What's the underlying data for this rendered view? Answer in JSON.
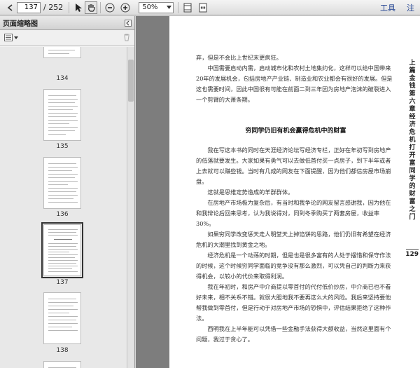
{
  "toolbar": {
    "current_page": "137",
    "page_total": "/ 252",
    "zoom": "50%",
    "tools_label": "工具",
    "comment_label": "注"
  },
  "sidebar": {
    "title": "页面缩略图",
    "thumbnails": [
      {
        "label": "134"
      },
      {
        "label": "135"
      },
      {
        "label": "136"
      },
      {
        "label": "137",
        "selected": true
      },
      {
        "label": "138"
      }
    ]
  },
  "document": {
    "running_head": "上篇 金钱 第六章 经济危机打开富同学的财富之门",
    "page_number": "129",
    "top_paragraphs": [
      "弃，但是不会比上世纪末更疯狂。",
      "中国需要启动内需，启动城市化和农村土地集约化，这样可以给中国带来20年的发展机会，包括房地产产业链、制造业和农业都会有很好的发展。但是这也需要时间，因此中国很有可能在前面二到三年因为房地产泡沫的破裂进入一个剪臂的大萧条期。"
    ],
    "heading": "穷同学仍旧有机会赢得危机中的财富",
    "paragraphs": [
      "我在写这本书的同时在天涯经济论坛写经济专栏，正好在年初写到房地产的低落就要发生。大家如果有勇气可以去做低首付买一点房子，到下半年或者上去就可以赚些钱。当时有几成的网友在下面提醒，因为他们都信房屋市场崩盘。",
      "这就是思维定势造成的羊群群体。",
      "在房地产市场极为复杂后，有当时和我争论的网友留言感谢我，因为他在和我辩论后回来思考，认为我说得对，同到冬季购买了两套房屋，收益率30%。",
      "如果穷同学改变惩天走人明堂天上掉馅饼的思路，他们仍旧有希望在经济危机的大潮里找到黄金之地。",
      "经济危机是一个动荡的时期，但是也是很多富有的人处于摆惜和保守作法的时候，这个时候穷同学面临的竞争没有那么激烈，可以凭自己的判断力来获得机会，以较小的代价来取得利润。",
      "我在年初时，和房产中介商提以零首付的代付低价炒房，中介商已也不看好未来，相不关系不错。就很大胆地我不要再这么大的风险。我后来坚持要他帮我做到零首付，但是行动于对房地产市场的恐惧中，评估结果拒绝了这种作法。",
      "西明我在上半年能可以凭借一些金融手法获得大额收益，当然这里面有个问题，我过于贪心了。"
    ]
  }
}
